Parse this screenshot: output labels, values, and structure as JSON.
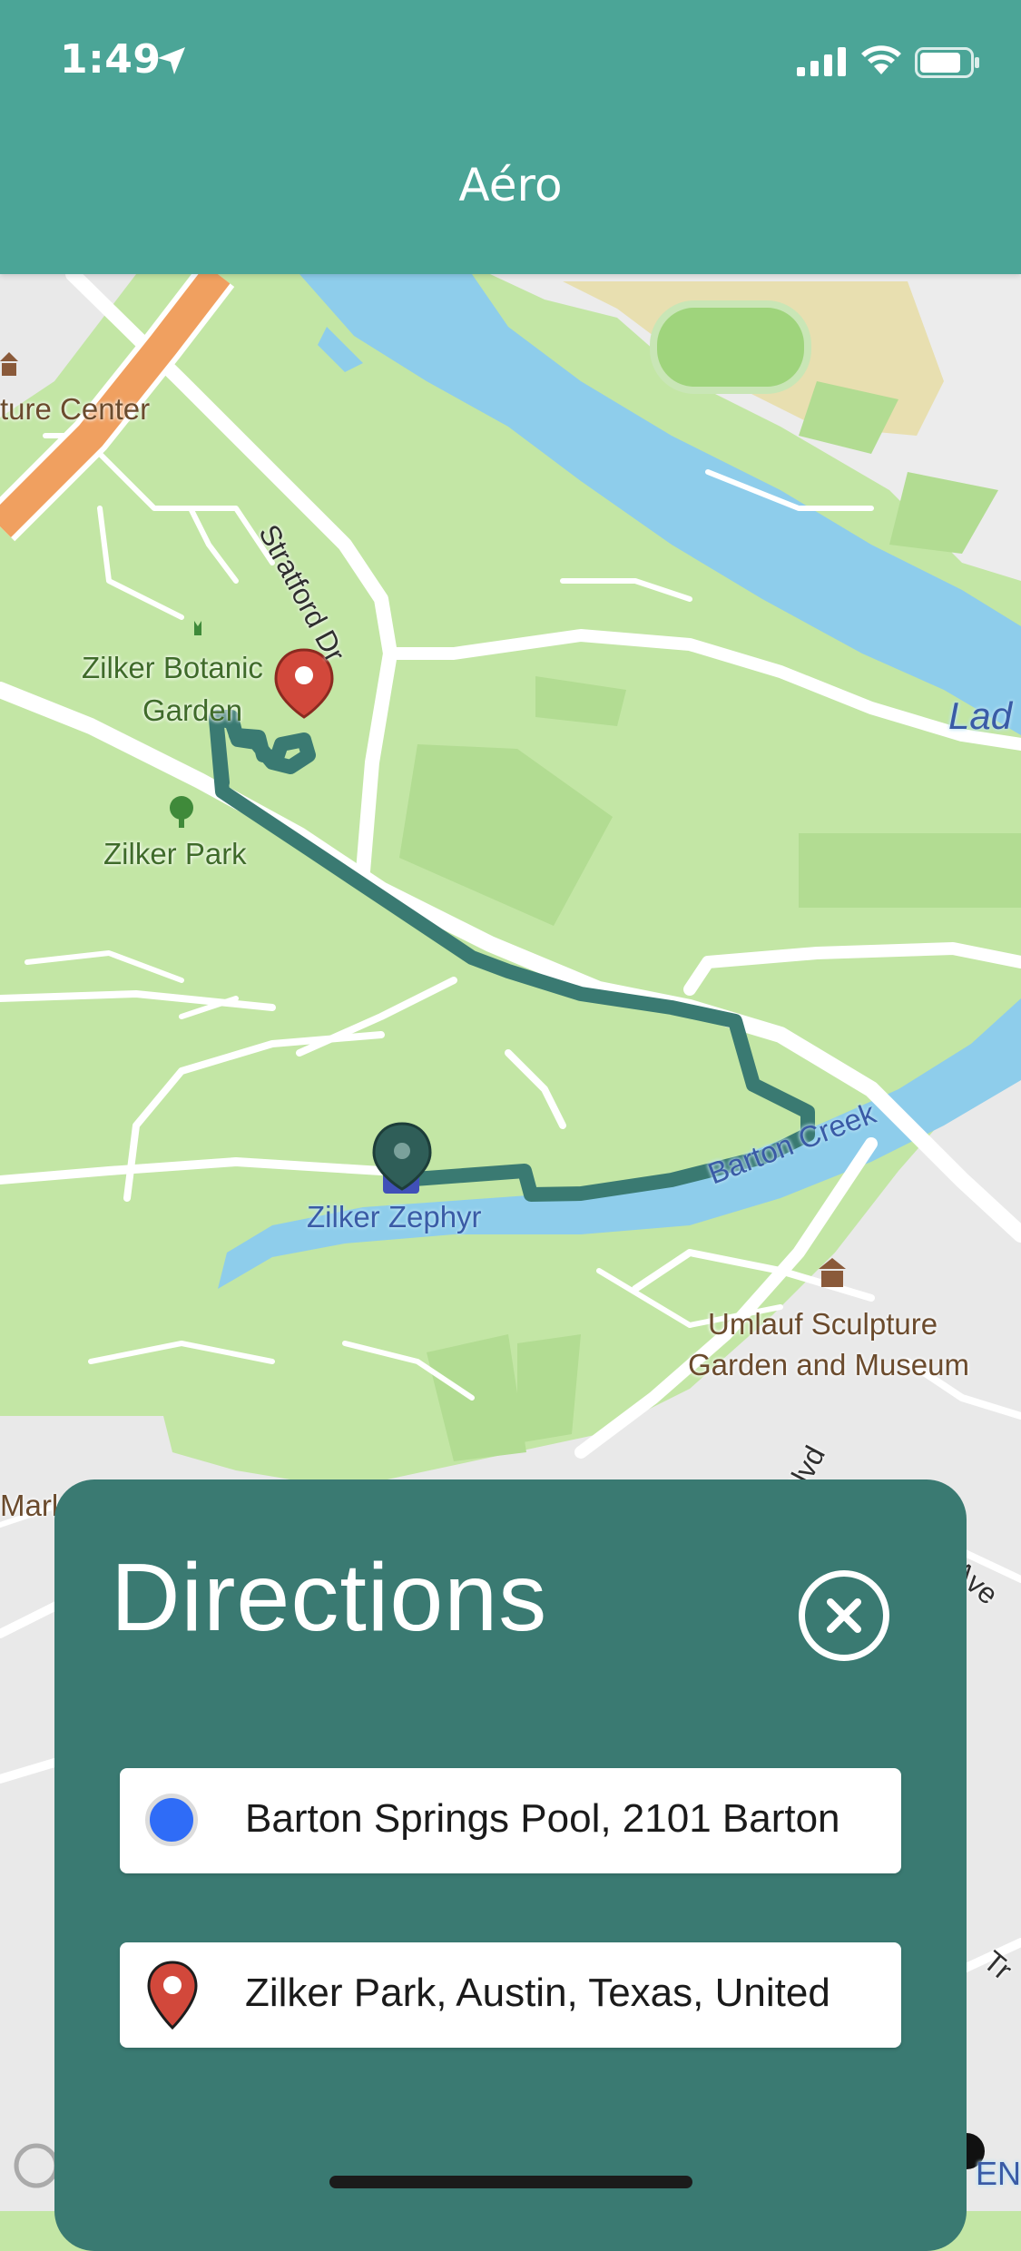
{
  "status_bar": {
    "time": "1:49"
  },
  "header": {
    "title": "Aéro"
  },
  "map": {
    "labels": {
      "culture_center": "ture Center",
      "stratford": "Stratford Dr",
      "botanic_1": "Zilker Botanic",
      "botanic_2": "Garden",
      "zilker_park": "Zilker Park",
      "lady": "Lad",
      "zephyr": "Zilker Zephyr",
      "barton_creek": "Barton Creek",
      "umlauf_1": "Umlauf Sculpture",
      "umlauf_2": "Garden and Museum",
      "mark": "Mark",
      "blvd": "Blvd",
      "ave": "Ave",
      "tr": "Tr",
      "bottom_right": "EN"
    },
    "colors": {
      "park": "#c3e6a5",
      "park_dark": "#b2dc92",
      "water": "#8ecdeb",
      "urban": "#ececec",
      "route": "#3a7a72",
      "highway": "#f0a060",
      "start_pin": "#2f5e58",
      "end_pin": "#d2483b"
    }
  },
  "directions": {
    "title": "Directions",
    "close_icon": "close-icon",
    "start_value": "Barton Springs Pool, 2101 Barton",
    "end_value": "Zilker Park, Austin, Texas, United"
  }
}
